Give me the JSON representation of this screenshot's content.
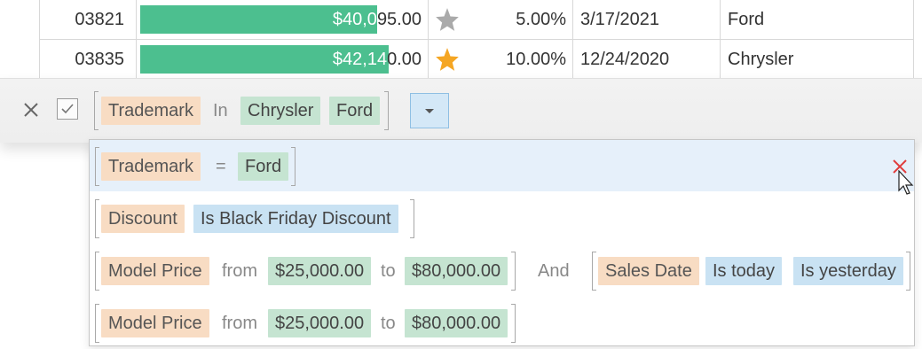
{
  "grid": {
    "rows": [
      {
        "id": "03821",
        "price": "$40,095.00",
        "price_in_bar": "$40,0",
        "price_rest": "95.00",
        "price_fill": 0.82,
        "discount": "5.00%",
        "date": "3/17/2021",
        "trademark": "Ford",
        "star_color": "#aaaaaa"
      },
      {
        "id": "03835",
        "price": "$42,140.00",
        "price_in_bar": "$42,14",
        "price_rest": "0.00",
        "price_fill": 0.86,
        "discount": "10.00%",
        "date": "12/24/2020",
        "trademark": "Chrysler",
        "star_color": "#f5a623"
      }
    ]
  },
  "filterbar": {
    "close_icon": "close-icon",
    "check_icon": "check-icon",
    "field": "Trademark",
    "operator": "In",
    "values": [
      "Chrysler",
      "Ford"
    ],
    "dropdown_icon": "chevron-down-icon"
  },
  "popup": {
    "items": [
      {
        "field": "Trademark",
        "operator": "=",
        "value": "Ford"
      },
      {
        "field": "Discount",
        "value": "Is Black Friday Discount"
      },
      {
        "field": "Model Price",
        "from_label": "from",
        "from": "$25,000.00",
        "to_label": "to",
        "to": "$80,000.00",
        "joiner": "And",
        "field2": "Sales Date",
        "value2a": "Is today",
        "value2b": "Is yesterday"
      },
      {
        "field": "Model Price",
        "from_label": "from",
        "from": "$25,000.00",
        "to_label": "to",
        "to": "$80,000.00"
      }
    ],
    "remove_icon": "remove-icon"
  },
  "colors": {
    "field_token": "#f8dcc3",
    "value_token": "#c5e4d1",
    "blue_token": "#c9e2f3",
    "bar": "#4cbf8f",
    "remove": "#e03c3c"
  }
}
